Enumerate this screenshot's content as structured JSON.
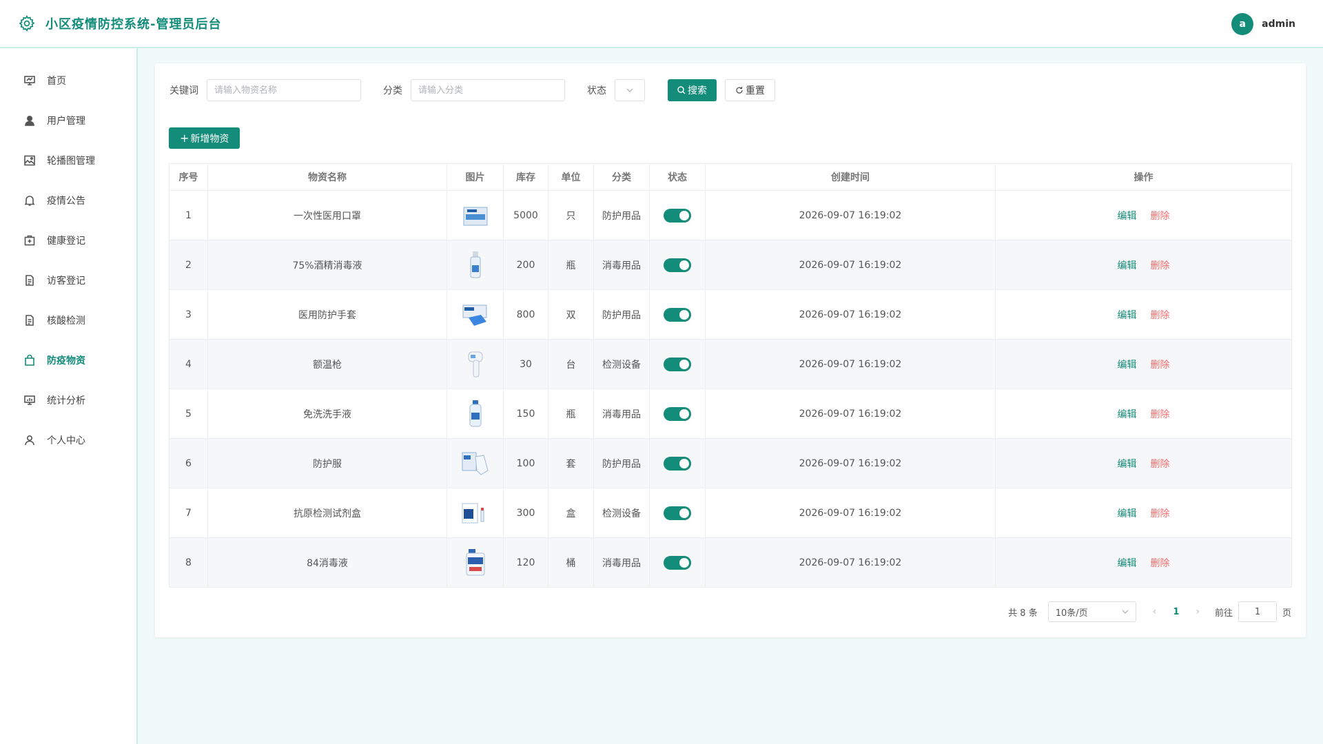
{
  "header": {
    "title": "小区疫情防控系统-管理员后台",
    "avatar_letter": "a",
    "username": "admin"
  },
  "sidebar": {
    "items": [
      {
        "label": "首页",
        "icon": "dashboard-icon"
      },
      {
        "label": "用户管理",
        "icon": "user-icon"
      },
      {
        "label": "轮播图管理",
        "icon": "image-icon"
      },
      {
        "label": "疫情公告",
        "icon": "bell-icon"
      },
      {
        "label": "健康登记",
        "icon": "medical-box-icon"
      },
      {
        "label": "访客登记",
        "icon": "document-icon"
      },
      {
        "label": "核酸检测",
        "icon": "document-icon"
      },
      {
        "label": "防疫物资",
        "icon": "bag-icon",
        "active": true
      },
      {
        "label": "统计分析",
        "icon": "chart-icon"
      },
      {
        "label": "个人中心",
        "icon": "user-outline-icon"
      }
    ]
  },
  "search": {
    "keyword_label": "关键词",
    "keyword_placeholder": "请输入物资名称",
    "category_label": "分类",
    "category_placeholder": "请输入分类",
    "status_label": "状态",
    "search_button": "搜索",
    "reset_button": "重置"
  },
  "add_button": "新增物资",
  "table": {
    "headers": [
      "序号",
      "物资名称",
      "图片",
      "库存",
      "单位",
      "分类",
      "状态",
      "创建时间",
      "操作"
    ],
    "edit_label": "编辑",
    "delete_label": "删除",
    "rows": [
      {
        "no": "1",
        "name": "一次性医用口罩",
        "stock": "5000",
        "unit": "只",
        "category": "防护用品",
        "status": true,
        "created": "2026-09-07 16:19:02",
        "img": "mask"
      },
      {
        "no": "2",
        "name": "75%酒精消毒液",
        "stock": "200",
        "unit": "瓶",
        "category": "消毒用品",
        "status": true,
        "created": "2026-09-07 16:19:02",
        "img": "spray"
      },
      {
        "no": "3",
        "name": "医用防护手套",
        "stock": "800",
        "unit": "双",
        "category": "防护用品",
        "status": true,
        "created": "2026-09-07 16:19:02",
        "img": "gloves"
      },
      {
        "no": "4",
        "name": "额温枪",
        "stock": "30",
        "unit": "台",
        "category": "检测设备",
        "status": true,
        "created": "2026-09-07 16:19:02",
        "img": "thermometer"
      },
      {
        "no": "5",
        "name": "免洗洗手液",
        "stock": "150",
        "unit": "瓶",
        "category": "消毒用品",
        "status": true,
        "created": "2026-09-07 16:19:02",
        "img": "sanitizer"
      },
      {
        "no": "6",
        "name": "防护服",
        "stock": "100",
        "unit": "套",
        "category": "防护用品",
        "status": true,
        "created": "2026-09-07 16:19:02",
        "img": "suit"
      },
      {
        "no": "7",
        "name": "抗原检测试剂盒",
        "stock": "300",
        "unit": "盒",
        "category": "检测设备",
        "status": true,
        "created": "2026-09-07 16:19:02",
        "img": "kit"
      },
      {
        "no": "8",
        "name": "84消毒液",
        "stock": "120",
        "unit": "桶",
        "category": "消毒用品",
        "status": true,
        "created": "2026-09-07 16:19:02",
        "img": "bucket"
      }
    ]
  },
  "pagination": {
    "total_text": "共 8 条",
    "page_size": "10条/页",
    "current_page": "1",
    "goto_label": "前往",
    "goto_value": "1",
    "page_suffix": "页"
  }
}
